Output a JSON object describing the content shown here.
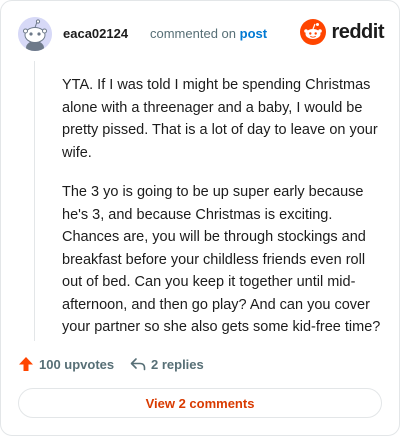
{
  "comment": {
    "username": "eaca02124",
    "commented_on_text": "commented on",
    "post_link_text": "post",
    "paragraphs": [
      "YTA. If I was told I might be spending Christmas alone with a threenager and a baby, I would be pretty pissed. That is a lot of day to leave on your wife.",
      "The 3 yo is going to be up super early because he's 3, and because Christmas is exciting. Chances are, you will be through stockings and breakfast before your childless friends even roll out of bed. Can you keep it together until mid-afternoon, and then go play? And can you cover your partner so she also gets some kid-free time?"
    ]
  },
  "brand": {
    "logo_text": "reddit",
    "logo_color": "#ff4500"
  },
  "actions": {
    "upvotes_label": "100 upvotes",
    "replies_label": "2 replies",
    "upvote_color": "#ff4500"
  },
  "view_comments_label": "View 2 comments",
  "icons": {
    "avatar": "snoo-avatar-icon",
    "logo": "reddit-logo-icon",
    "upvote": "upvote-arrow-icon",
    "reply": "reply-arrow-icon"
  }
}
